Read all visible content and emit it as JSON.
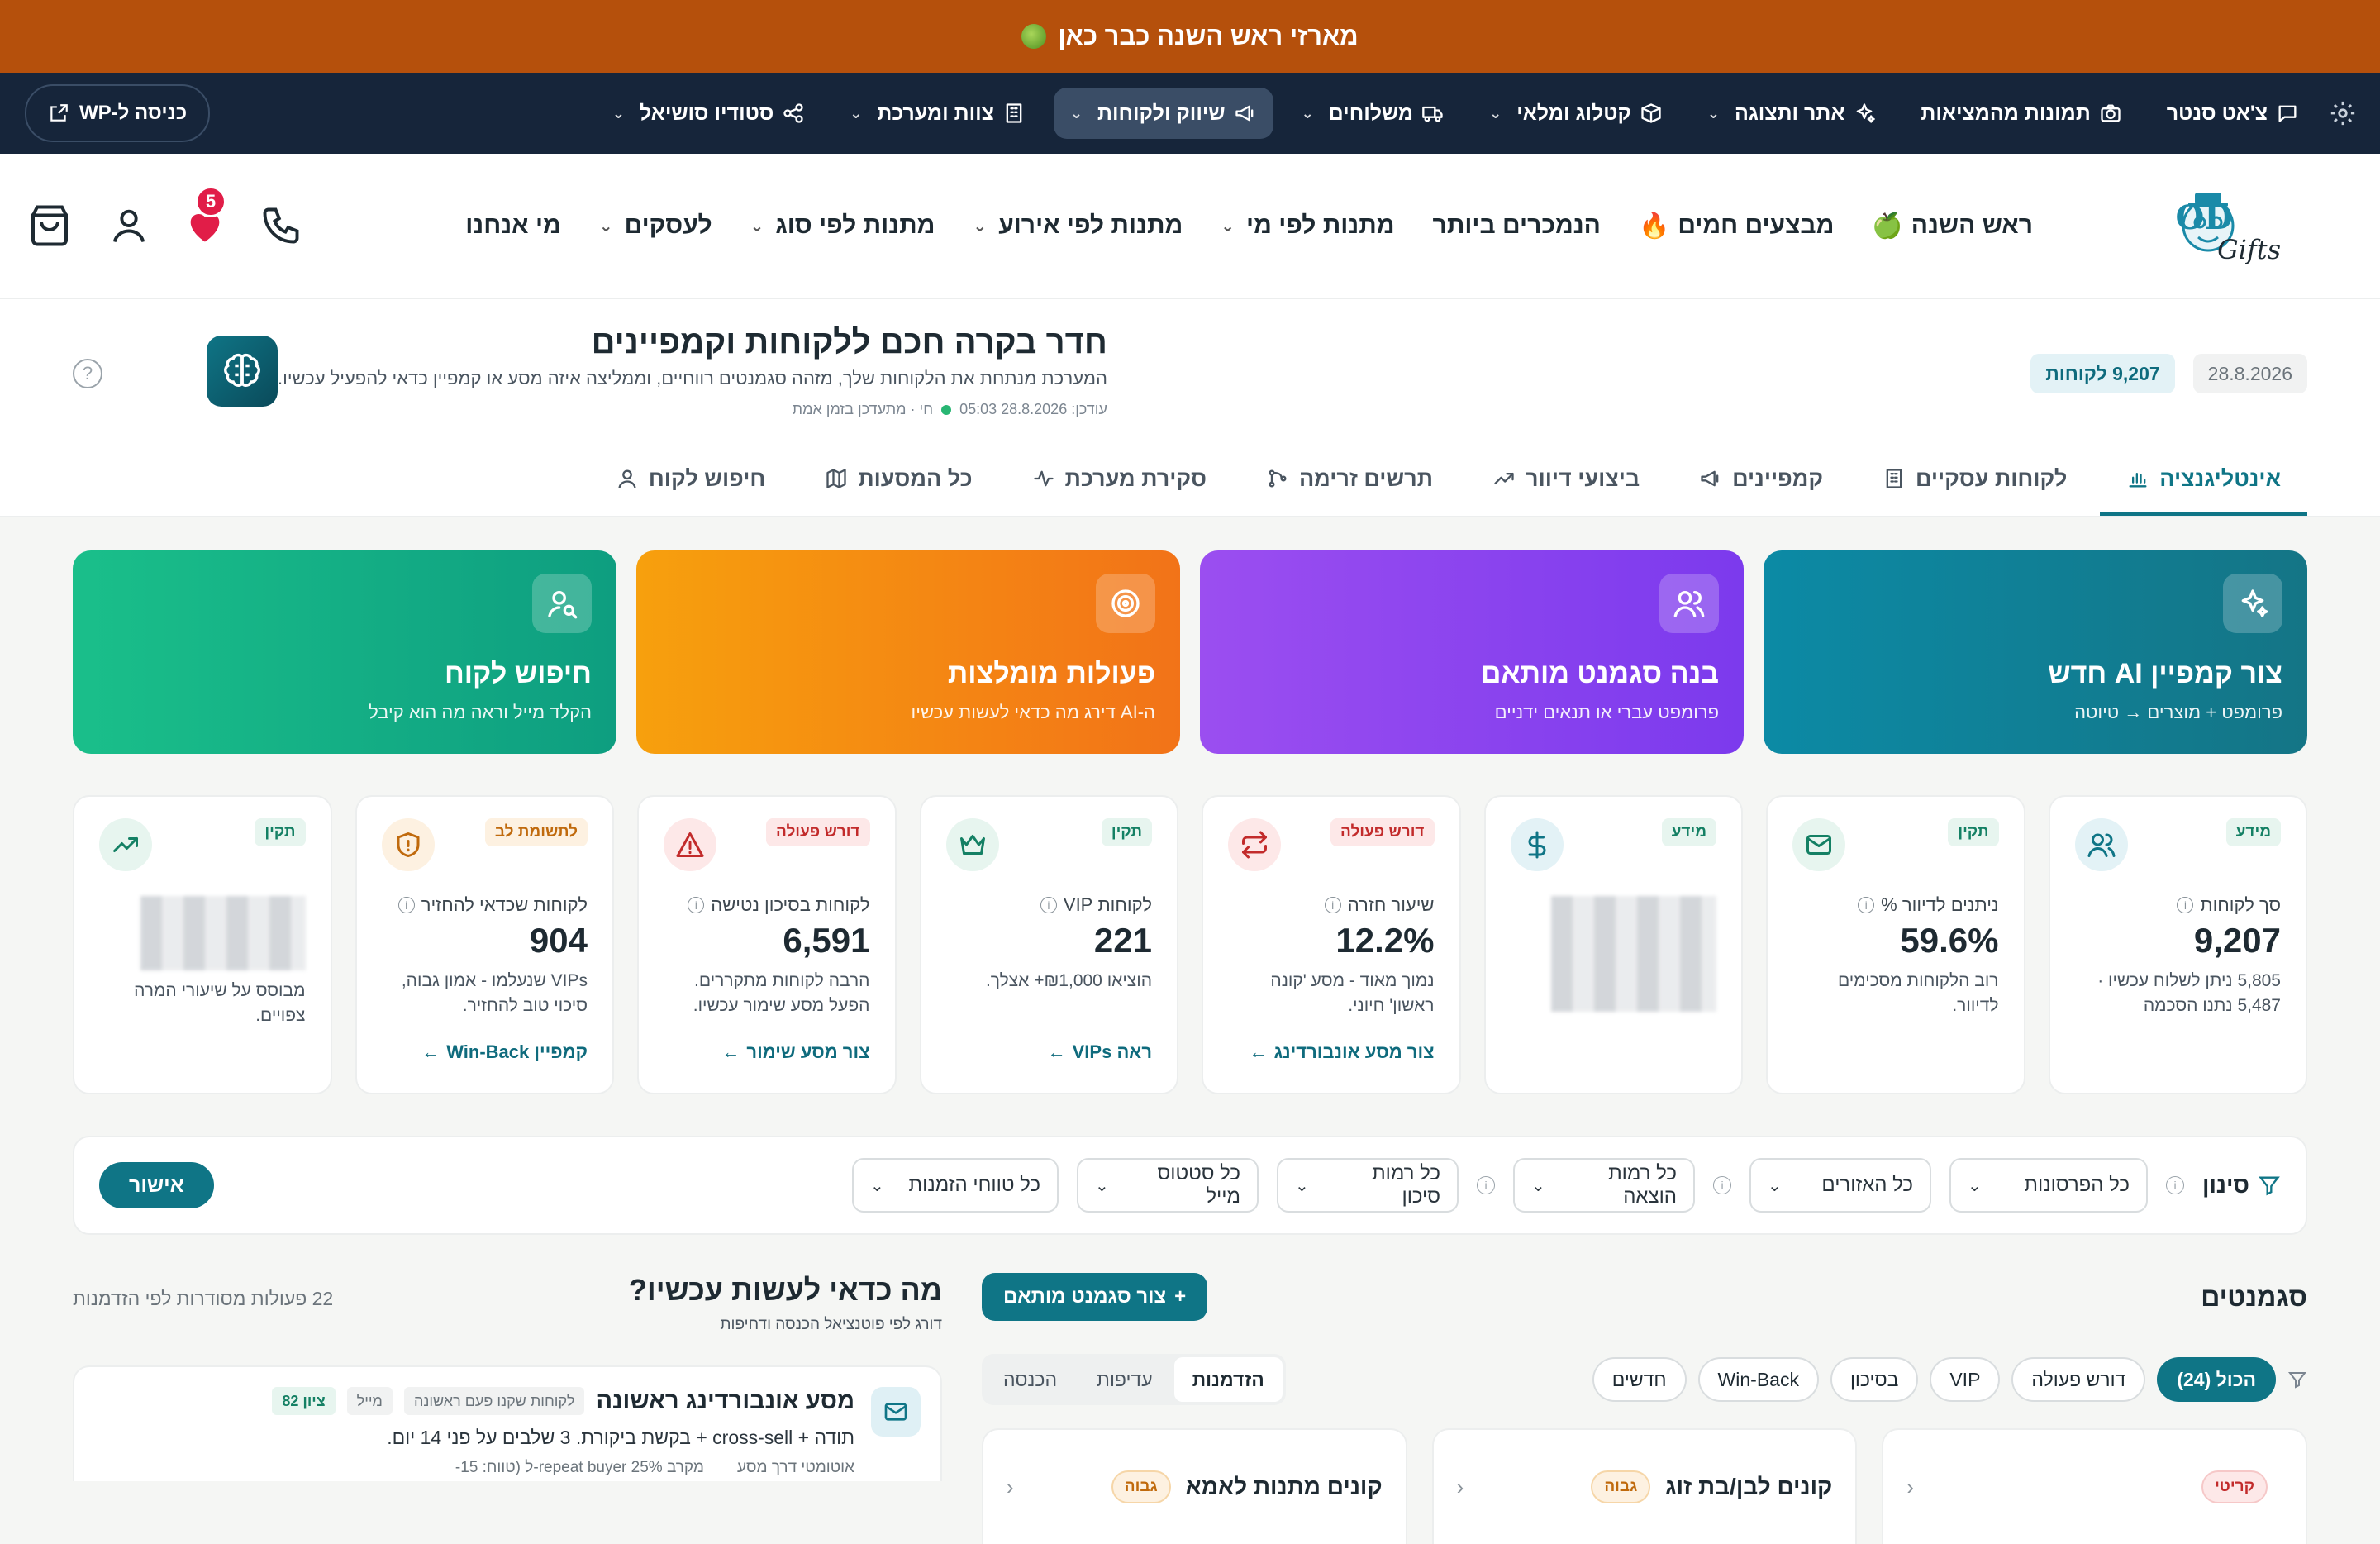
{
  "promo": {
    "text": "מארזי ראש השנה כבר כאן"
  },
  "admin_bar": {
    "items": [
      {
        "label": "צ'אט סנטר",
        "icon": "chat-icon",
        "chevron": false
      },
      {
        "label": "תמונות מהמציאות",
        "icon": "camera-icon",
        "chevron": false
      },
      {
        "label": "אתר ותצוגה",
        "icon": "sparkles-icon",
        "chevron": true
      },
      {
        "label": "קטלוג ומלאי",
        "icon": "box-icon",
        "chevron": true
      },
      {
        "label": "משלוחים",
        "icon": "truck-icon",
        "chevron": true
      },
      {
        "label": "שיווק ולקוחות",
        "icon": "megaphone-icon",
        "chevron": true,
        "active": true
      },
      {
        "label": "צוות ומערכת",
        "icon": "building-icon",
        "chevron": true
      },
      {
        "label": "סטודיו סושיאל",
        "icon": "share-icon",
        "chevron": true
      }
    ],
    "wp_button": "כניסה ל-WP"
  },
  "nav": {
    "logo_text": "HASOD",
    "logo_sub": "Gifts",
    "links": [
      {
        "label": "ראש השנה",
        "emoji": "🍏",
        "chevron": false
      },
      {
        "label": "מבצעים חמים",
        "emoji": "🔥",
        "chevron": false
      },
      {
        "label": "הנמכרים ביותר",
        "emoji": "",
        "chevron": false
      },
      {
        "label": "מתנות לפי מי",
        "emoji": "",
        "chevron": true
      },
      {
        "label": "מתנות לפי אירוע",
        "emoji": "",
        "chevron": true
      },
      {
        "label": "מתנות לפי סוג",
        "emoji": "",
        "chevron": true
      },
      {
        "label": "לעסקים",
        "emoji": "",
        "chevron": true
      },
      {
        "label": "מי אנחנו",
        "emoji": "",
        "chevron": false
      }
    ],
    "wishlist_count": "5"
  },
  "hero": {
    "title": "חדר בקרה חכם ללקוחות וקמפיינים",
    "subtitle": "המערכת מנתחת את הלקוחות שלך, מזהה סגמנטים רווחיים, וממליצה איזה מסע או קמפיין כדאי להפעיל עכשיו.",
    "updated": "עודכן: 28.8.2026 05:03",
    "live": "חי · מתעדכן בזמן אמת",
    "date_chip": "28.8.2026",
    "customers_chip": "9,207 לקוחות"
  },
  "tabs": [
    {
      "label": "אינטליגנציה",
      "icon": "bar-chart-icon",
      "active": true
    },
    {
      "label": "לקוחות עסקיים",
      "icon": "building-icon"
    },
    {
      "label": "קמפיינים",
      "icon": "megaphone-icon"
    },
    {
      "label": "ביצועי דיוור",
      "icon": "trend-icon"
    },
    {
      "label": "תרשים זרימה",
      "icon": "flow-icon"
    },
    {
      "label": "סקירת מערכת",
      "icon": "pulse-icon"
    },
    {
      "label": "כל המסעות",
      "icon": "map-icon"
    },
    {
      "label": "חיפוש לקוח",
      "icon": "user-icon"
    }
  ],
  "action_cards": [
    {
      "title": "צור קמפיין AI חדש",
      "subtitle": "פרומפט + מוצרים → טיוטה",
      "icon": "sparkles-icon",
      "color": "#0c8aa5"
    },
    {
      "title": "בנה סגמנט מותאם",
      "subtitle": "פרומפט עברי או תנאים ידניים",
      "icon": "users-icon",
      "color": "#8b45ef"
    },
    {
      "title": "פעולות מומלצות",
      "subtitle": "ה-AI דירג מה כדאי לעשות עכשיו",
      "icon": "target-icon",
      "color": "#f58a14"
    },
    {
      "title": "חיפוש לקוח",
      "subtitle": "הקלד מייל וראה מה הוא קיבל",
      "icon": "user-search-icon",
      "color": "#14b087"
    }
  ],
  "kpis": [
    {
      "badge": "מידע",
      "badge_type": "info",
      "label": "סך לקוחות",
      "value": "9,207",
      "desc": "5,805 ניתן לשלוח עכשיו · 5,487 נתנו הסכמה",
      "link": "",
      "icon": "users-icon",
      "icon_bg": "#e3f2f6",
      "icon_color": "#0f7586"
    },
    {
      "badge": "תקין",
      "badge_type": "ok",
      "label": "ניתנים לדיוור %",
      "value": "59.6%",
      "desc": "רוב הלקוחות מסכימים לדיוור.",
      "link": "",
      "icon": "mail-icon",
      "icon_bg": "#e7f5ef",
      "icon_color": "#148064"
    },
    {
      "badge": "מידע",
      "badge_type": "info",
      "label": "",
      "value": "",
      "desc": "",
      "link": "",
      "icon": "dollar-icon",
      "icon_bg": "#e3f2f6",
      "icon_color": "#0f7586",
      "blurred": true
    },
    {
      "badge": "דורש פעולה",
      "badge_type": "act",
      "label": "שיעור חזרה",
      "value": "12.2%",
      "desc": "נמוך מאוד - מסע 'קונה ראשון' חיוני.",
      "link": "צור מסע אונבורדינג",
      "icon": "repeat-icon",
      "icon_bg": "#fde8e8",
      "icon_color": "#c22b2b"
    },
    {
      "badge": "תקין",
      "badge_type": "ok",
      "label": "לקוחות VIP",
      "value": "221",
      "desc": "הוציאו ₪1,000+ אצלך.",
      "link": "ראה VIPs",
      "icon": "crown-icon",
      "icon_bg": "#e7f5ef",
      "icon_color": "#148064"
    },
    {
      "badge": "דורש פעולה",
      "badge_type": "act",
      "label": "לקוחות בסיכון נטישה",
      "value": "6,591",
      "desc": "הרבה לקוחות מתקררים. הפעל מסע שימור עכשיו.",
      "link": "צור מסע שימור",
      "icon": "alert-icon",
      "icon_bg": "#fde8e8",
      "icon_color": "#c22b2b"
    },
    {
      "badge": "לתשומת לב",
      "badge_type": "att",
      "label": "לקוחות שכדאי להחזיר",
      "value": "904",
      "desc": "VIPs שנעלמו - אמון גבוה, סיכוי טוב להחזיר.",
      "link": "קמפיין Win-Back",
      "icon": "shield-icon",
      "icon_bg": "#fdf1e1",
      "icon_color": "#c06a0d"
    },
    {
      "badge": "תקין",
      "badge_type": "ok",
      "label": "",
      "value": "",
      "desc": "מבוסס על שיעורי המרה צפויים.",
      "link": "",
      "icon": "trend-icon",
      "icon_bg": "#e7f5ef",
      "icon_color": "#148064",
      "blurred": true
    }
  ],
  "filters": {
    "label": "סינון",
    "selects": [
      "כל הפרסונות",
      "כל האזורים",
      "כל רמות הוצאה",
      "כל רמות סיכון",
      "כל סטטוס מייל",
      "כל טווחי הזמנות"
    ],
    "apply": "אישור"
  },
  "segments": {
    "title": "סגמנטים",
    "add_button": "צור סגמנט מותאם",
    "pills": [
      "הכול (24)",
      "דורש פעולה",
      "VIP",
      "בסיכון",
      "Win-Back",
      "חדשים"
    ],
    "sort": [
      "הזדמנות",
      "עדיפות",
      "הכנסה"
    ],
    "cards": [
      {
        "priority": "קריטי",
        "priority_type": "crit",
        "title": ""
      },
      {
        "priority": "גבוה",
        "priority_type": "high",
        "title": "קונים לבן/בת זוג"
      },
      {
        "priority": "גבוה",
        "priority_type": "high",
        "title": "קונים מתנות לאמא"
      }
    ]
  },
  "todo": {
    "title": "מה כדאי לעשות עכשיו?",
    "subtitle": "דורג לפי פוטנציאל הכנסה ודחיפות",
    "count": "22 פעולות מסודרות לפי הזדמנות",
    "card": {
      "title": "מסע אונבורדינג ראשונה",
      "score": "ציון 82",
      "tag1": "מייל",
      "tag2": "לקוחות שקנו פעם ראשונה",
      "desc": "תודה + cross-sell + בקשת ביקורת. 3 שלבים על פני 14 יום.",
      "foot1": "אוטומטי דרך מסע",
      "foot2": "מקרב 25% repeat buyer-ל (טווח: 15-"
    }
  }
}
